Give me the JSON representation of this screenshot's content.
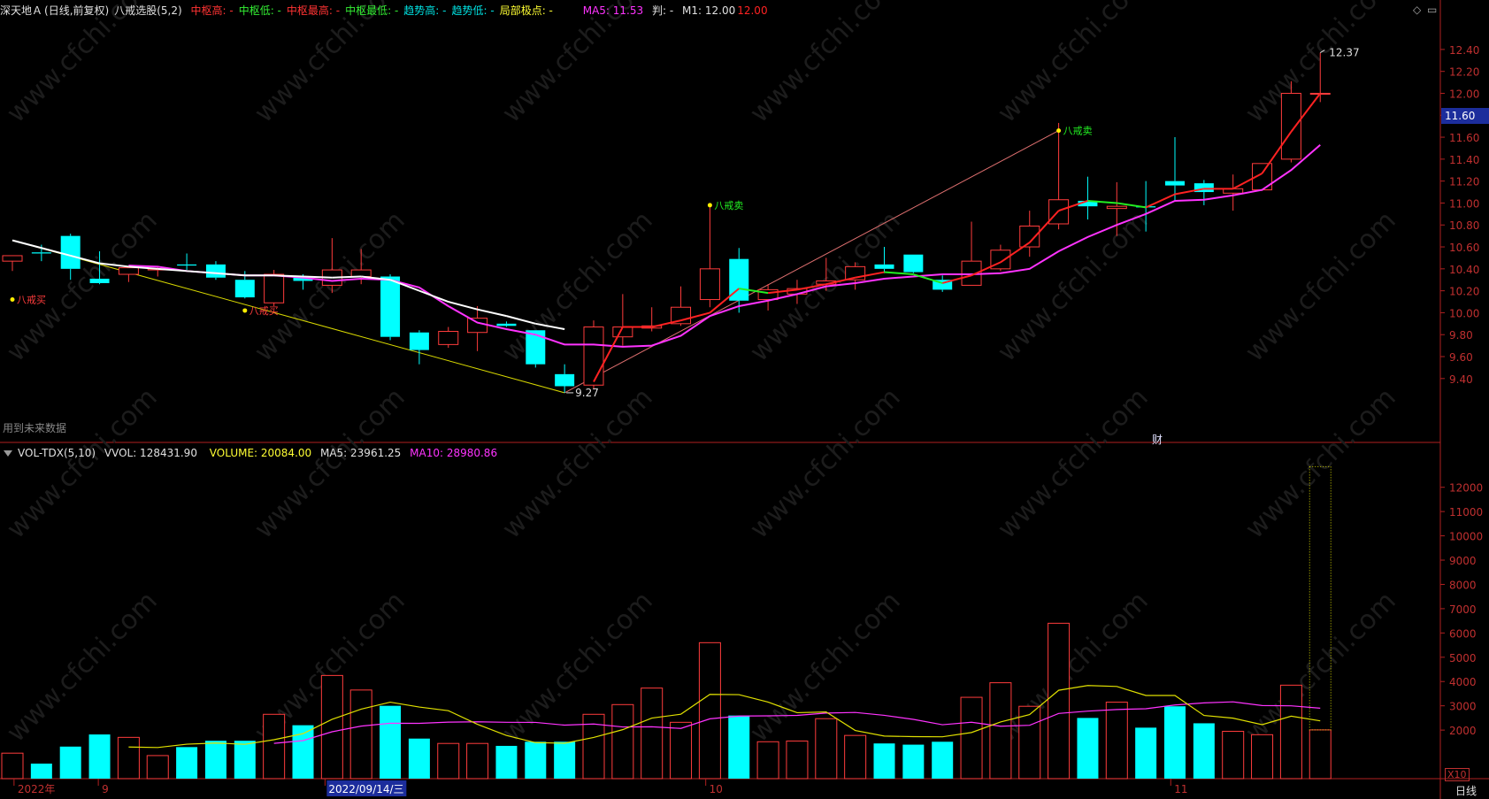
{
  "header": {
    "stock_name": "深天地Ａ",
    "stock_mode": "(日线,前复权)",
    "indicator": "八戒选股(5,2)",
    "items": [
      {
        "label": "中枢高: -",
        "color": "#ff3333"
      },
      {
        "label": "中枢低: -",
        "color": "#33ee33"
      },
      {
        "label": "中枢最高: -",
        "color": "#ff3333"
      },
      {
        "label": "中枢最低: -",
        "color": "#33ee33"
      },
      {
        "label": "趋势高: -",
        "color": "#00e0e0"
      },
      {
        "label": "趋势低: -",
        "color": "#00e0e0"
      },
      {
        "label": "局部极点: -",
        "color": "#ffff33"
      }
    ],
    "ma5_label": "MA5: 11.53",
    "pan_label": "判: -",
    "m1_label": "M1: 12.00",
    "m1_extra": "12.00"
  },
  "volume_header": {
    "name": "VOL-TDX(5,10)",
    "vvol": "VVOL: 128431.90",
    "volume": "VOLUME: 20084.00",
    "ma5": "MA5: 23961.25",
    "ma10": "MA10: 28980.86"
  },
  "notes": {
    "future_data": "用到未来数据",
    "cai": "财",
    "x10": "X10",
    "period": "日线",
    "current_price": "11.60",
    "high_label": "12.37",
    "low_label": "9.27"
  },
  "x_axis": {
    "labels": [
      {
        "text": "2022年",
        "i": 0.3,
        "highlight": false
      },
      {
        "text": "9",
        "i": 3.2,
        "highlight": false
      },
      {
        "text": "2022/09/14/三",
        "i": 11.0,
        "highlight": true
      },
      {
        "text": "10",
        "i": 24.1,
        "highlight": false
      },
      {
        "text": "11",
        "i": 40.1,
        "highlight": false
      }
    ]
  },
  "chart_data": {
    "type": "candlestick",
    "price_axis": {
      "ylim": [
        9.1,
        12.52
      ],
      "ticks": [
        "9.40",
        "9.60",
        "9.80",
        "10.00",
        "10.20",
        "10.40",
        "10.60",
        "10.80",
        "11.00",
        "11.20",
        "11.40",
        "11.60",
        "11.80",
        "12.00",
        "12.20",
        "12.40"
      ]
    },
    "volume_axis": {
      "ylim": [
        0,
        12900
      ],
      "ticks": [
        "2000",
        "3000",
        "4000",
        "5000",
        "6000",
        "7000",
        "8000",
        "9000",
        "10000",
        "11000",
        "12000"
      ],
      "multiplier_label": "X10"
    },
    "candles": [
      {
        "o": 10.47,
        "h": 10.52,
        "l": 10.38,
        "c": 10.52,
        "v": 1050
      },
      {
        "o": 10.55,
        "h": 10.62,
        "l": 10.47,
        "c": 10.54,
        "v": 620
      },
      {
        "o": 10.7,
        "h": 10.72,
        "l": 10.3,
        "c": 10.4,
        "v": 1320
      },
      {
        "o": 10.31,
        "h": 10.56,
        "l": 10.26,
        "c": 10.27,
        "v": 1820
      },
      {
        "o": 10.35,
        "h": 10.42,
        "l": 10.28,
        "c": 10.41,
        "v": 1700
      },
      {
        "o": 10.39,
        "h": 10.42,
        "l": 10.33,
        "c": 10.4,
        "v": 950
      },
      {
        "o": 10.44,
        "h": 10.54,
        "l": 10.39,
        "c": 10.43,
        "v": 1300
      },
      {
        "o": 10.44,
        "h": 10.47,
        "l": 10.3,
        "c": 10.32,
        "v": 1560
      },
      {
        "o": 10.3,
        "h": 10.38,
        "l": 10.13,
        "c": 10.14,
        "v": 1560
      },
      {
        "o": 10.09,
        "h": 10.39,
        "l": 10.06,
        "c": 10.35,
        "v": 2650
      },
      {
        "o": 10.32,
        "h": 10.35,
        "l": 10.21,
        "c": 10.29,
        "v": 2200
      },
      {
        "o": 10.25,
        "h": 10.68,
        "l": 10.18,
        "c": 10.39,
        "v": 4250
      },
      {
        "o": 10.33,
        "h": 10.58,
        "l": 10.26,
        "c": 10.39,
        "v": 3650
      },
      {
        "o": 10.33,
        "h": 10.35,
        "l": 9.75,
        "c": 9.78,
        "v": 3000
      },
      {
        "o": 9.82,
        "h": 9.84,
        "l": 9.53,
        "c": 9.66,
        "v": 1650
      },
      {
        "o": 9.71,
        "h": 9.87,
        "l": 9.68,
        "c": 9.83,
        "v": 1450
      },
      {
        "o": 9.82,
        "h": 10.06,
        "l": 9.65,
        "c": 9.95,
        "v": 1450
      },
      {
        "o": 9.9,
        "h": 9.92,
        "l": 9.87,
        "c": 9.88,
        "v": 1350
      },
      {
        "o": 9.84,
        "h": 9.84,
        "l": 9.5,
        "c": 9.53,
        "v": 1520
      },
      {
        "o": 9.44,
        "h": 9.53,
        "l": 9.27,
        "c": 9.33,
        "v": 1520
      },
      {
        "o": 9.34,
        "h": 9.93,
        "l": 9.3,
        "c": 9.87,
        "v": 2650
      },
      {
        "o": 9.78,
        "h": 10.17,
        "l": 9.7,
        "c": 9.87,
        "v": 3050
      },
      {
        "o": 9.86,
        "h": 10.05,
        "l": 9.83,
        "c": 9.88,
        "v": 3730
      },
      {
        "o": 9.9,
        "h": 10.24,
        "l": 9.88,
        "c": 10.05,
        "v": 2320
      },
      {
        "o": 10.12,
        "h": 10.96,
        "l": 10.05,
        "c": 10.4,
        "v": 5600
      },
      {
        "o": 10.49,
        "h": 10.59,
        "l": 10.0,
        "c": 10.11,
        "v": 2600
      },
      {
        "o": 10.12,
        "h": 10.26,
        "l": 10.02,
        "c": 10.21,
        "v": 1520
      },
      {
        "o": 10.17,
        "h": 10.3,
        "l": 10.08,
        "c": 10.22,
        "v": 1550
      },
      {
        "o": 10.26,
        "h": 10.5,
        "l": 10.2,
        "c": 10.29,
        "v": 2470
      },
      {
        "o": 10.3,
        "h": 10.46,
        "l": 10.21,
        "c": 10.42,
        "v": 1780
      },
      {
        "o": 10.44,
        "h": 10.6,
        "l": 10.36,
        "c": 10.4,
        "v": 1450
      },
      {
        "o": 10.53,
        "h": 10.53,
        "l": 10.36,
        "c": 10.37,
        "v": 1400
      },
      {
        "o": 10.3,
        "h": 10.34,
        "l": 10.19,
        "c": 10.21,
        "v": 1520
      },
      {
        "o": 10.25,
        "h": 10.83,
        "l": 10.25,
        "c": 10.47,
        "v": 3350
      },
      {
        "o": 10.4,
        "h": 10.62,
        "l": 10.38,
        "c": 10.57,
        "v": 3950
      },
      {
        "o": 10.6,
        "h": 10.93,
        "l": 10.51,
        "c": 10.79,
        "v": 2980
      },
      {
        "o": 10.81,
        "h": 11.73,
        "l": 10.76,
        "c": 11.03,
        "v": 6400
      },
      {
        "o": 11.02,
        "h": 11.24,
        "l": 10.85,
        "c": 10.97,
        "v": 2500
      },
      {
        "o": 10.95,
        "h": 11.19,
        "l": 10.7,
        "c": 10.97,
        "v": 3150
      },
      {
        "o": 10.97,
        "h": 11.2,
        "l": 10.74,
        "c": 10.96,
        "v": 2100
      },
      {
        "o": 11.2,
        "h": 11.6,
        "l": 11.02,
        "c": 11.16,
        "v": 2980
      },
      {
        "o": 11.18,
        "h": 11.21,
        "l": 10.98,
        "c": 11.1,
        "v": 2280
      },
      {
        "o": 11.09,
        "h": 11.26,
        "l": 10.93,
        "c": 11.13,
        "v": 1950
      },
      {
        "o": 11.12,
        "h": 11.3,
        "l": 11.11,
        "c": 11.36,
        "v": 1810
      },
      {
        "o": 11.4,
        "h": 12.11,
        "l": 11.37,
        "c": 12.0,
        "v": 3850
      },
      {
        "o": 12.0,
        "h": 12.37,
        "l": 11.92,
        "c": 12.0,
        "v": 2008
      }
    ],
    "series": [
      {
        "name": "MA5",
        "color": "#ff33ff",
        "values": [
          null,
          null,
          null,
          null,
          10.43,
          10.42,
          10.38,
          10.36,
          10.34,
          10.34,
          10.32,
          10.29,
          10.31,
          10.3,
          10.23,
          10.06,
          9.91,
          9.85,
          9.8,
          9.71,
          9.71,
          9.69,
          9.7,
          9.79,
          9.97,
          10.06,
          10.11,
          10.17,
          10.24,
          10.27,
          10.31,
          10.33,
          10.35,
          10.35,
          10.36,
          10.4,
          10.56,
          10.69,
          10.8,
          10.9,
          11.02,
          11.03,
          11.07,
          11.12,
          11.3,
          11.53
        ]
      },
      {
        "name": "M1",
        "color": "#ff2222",
        "values": [
          null,
          null,
          null,
          null,
          null,
          null,
          null,
          null,
          null,
          null,
          null,
          null,
          null,
          null,
          null,
          null,
          null,
          null,
          null,
          null,
          9.37,
          9.87,
          9.87,
          9.93,
          10.0,
          10.22,
          10.18,
          10.21,
          10.26,
          10.32,
          10.37,
          10.35,
          10.27,
          10.34,
          10.46,
          10.64,
          10.93,
          11.02,
          11.0,
          10.96,
          11.08,
          11.13,
          11.13,
          11.27,
          11.65,
          12.0
        ]
      }
    ]
  }
}
